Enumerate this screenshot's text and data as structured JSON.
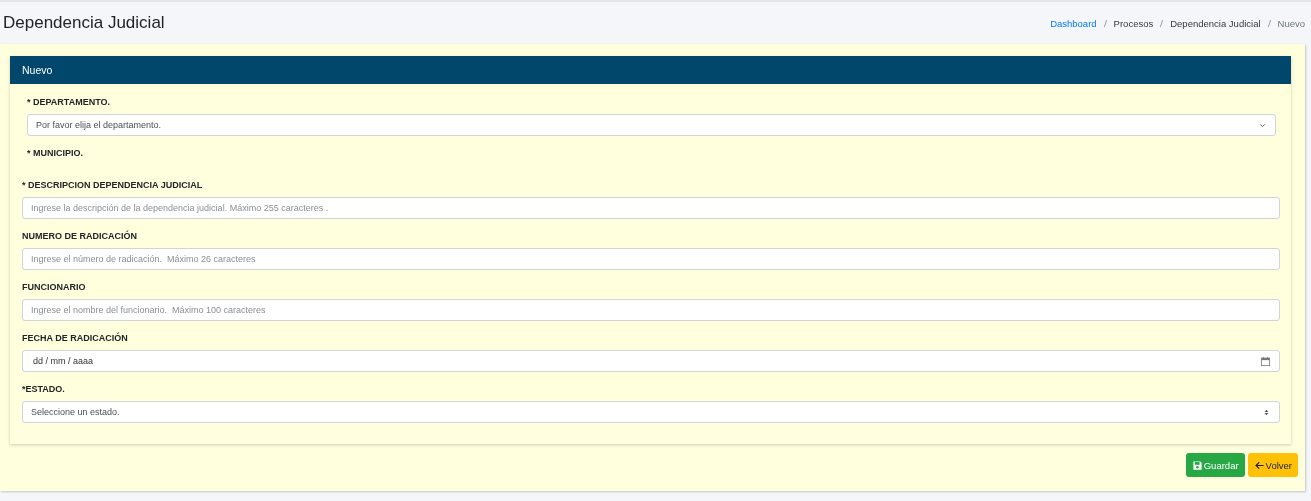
{
  "page_title": "Dependencia Judicial",
  "breadcrumb": [
    {
      "label": "Dashboard",
      "link": true
    },
    {
      "label": "Procesos",
      "link": false
    },
    {
      "label": "Dependencia Judicial",
      "link": false
    },
    {
      "label": "Nuevo",
      "link": false
    }
  ],
  "card": {
    "title": "Nuevo",
    "fields": [
      {
        "label": "* DEPARTAMENTO.",
        "kind": "select",
        "value": "Por favor elija el departamento.",
        "indented": true
      },
      {
        "label": "* MUNICIPIO.",
        "kind": "none",
        "indented": true
      },
      {
        "label": "* DESCRIPCION DEPENDENCIA JUDICIAL",
        "kind": "text",
        "placeholder": "Ingrese la descripción de la dependencia judicial. Máximo 255 caracteres .",
        "indented": false
      },
      {
        "label": "NUMERO DE RADICACIÓN",
        "kind": "text",
        "placeholder": "Ingrese el número de radicación.  Máximo 26 caracteres",
        "indented": false
      },
      {
        "label": "FUNCIONARIO",
        "kind": "text",
        "placeholder": "Ingrese el nombre del funcionario.  Máximo 100 caracteres",
        "indented": false
      },
      {
        "label": "FECHA DE RADICACIÓN",
        "kind": "date",
        "value": "dd / mm / aaaa",
        "indented": false
      },
      {
        "label": "*ESTADO.",
        "kind": "spinner",
        "value": "Seleccione un estado.",
        "indented": false
      }
    ]
  },
  "buttons": [
    {
      "label": "Guardar",
      "kind": "save"
    },
    {
      "label": "Volver",
      "kind": "back"
    }
  ]
}
